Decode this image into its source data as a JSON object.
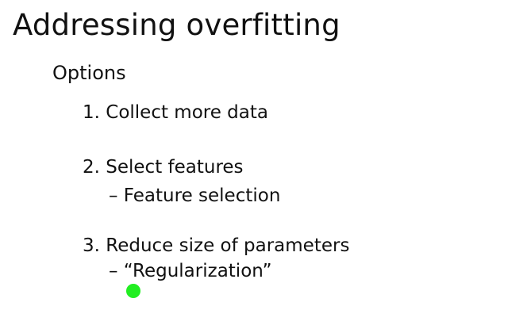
{
  "slide": {
    "title": "Addressing overfitting",
    "options_heading": "Options",
    "items": [
      {
        "label": "1. Collect more data",
        "sub": ""
      },
      {
        "label": "2. Select features",
        "sub": "– Feature selection"
      },
      {
        "label": "3. Reduce size of parameters",
        "sub": "– “Regularization”"
      }
    ]
  },
  "pointer": {
    "color": "#22ee22"
  }
}
